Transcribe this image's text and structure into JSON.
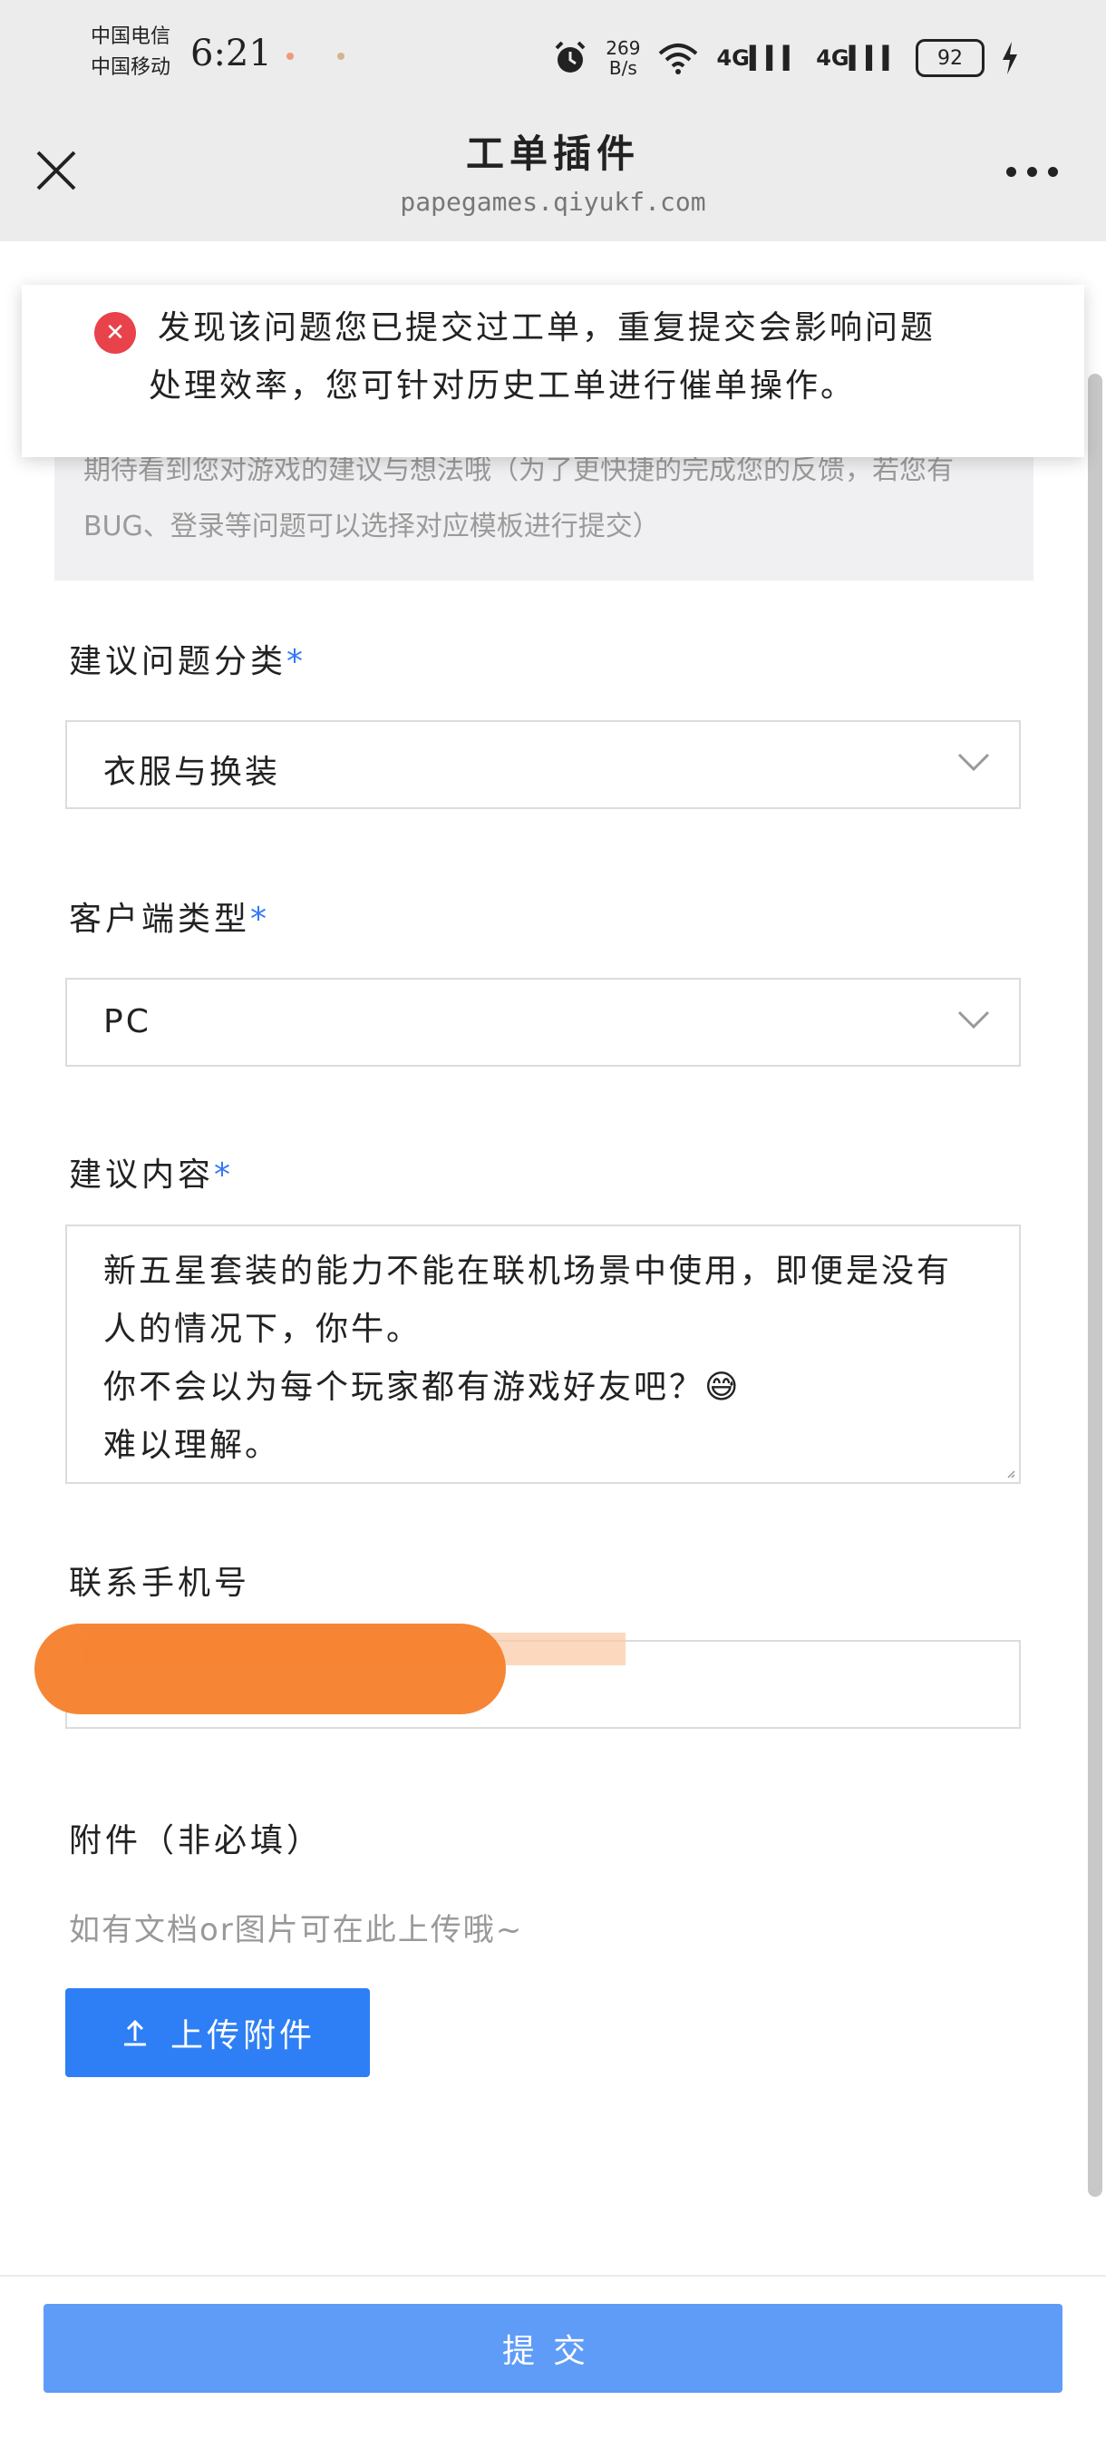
{
  "status_bar": {
    "carrier1": "中国电信",
    "carrier2": "中国移动",
    "time": "6:21",
    "speed_value": "269",
    "speed_unit": "B/s",
    "network1": "4G",
    "network2": "4G",
    "battery": "92"
  },
  "nav": {
    "title": "工单插件",
    "url": "papegames.qiyukf.com"
  },
  "toast": {
    "line1": "发现该问题您已提交过工单，重复提交会影响问题",
    "line2": "处理效率，您可针对历史工单进行催单操作。"
  },
  "intro": {
    "text": "期待看到您对游戏的建议与想法哦（为了更快捷的完成您的反馈，若您有BUG、登录等问题可以选择对应模板进行提交）"
  },
  "form": {
    "category_label": "建议问题分类",
    "category_value": "衣服与换装",
    "client_label": "客户端类型",
    "client_value": "PC",
    "content_label": "建议内容",
    "content_value": "新五星套装的能力不能在联机场景中使用，即便是没有人的情况下，你牛。\n你不会以为每个玩家都有游戏好友吧？😅\n难以理解。",
    "phone_label": "联系手机号",
    "attachment_label": "附件（非必填）",
    "attachment_hint": "如有文档or图片可在此上传哦~",
    "upload_label": "上传附件",
    "required_mark": "*"
  },
  "submit_label": "提交",
  "colors": {
    "accent": "#2e7ff5",
    "submit": "#5f9cf8",
    "error": "#e8424a",
    "redaction": "#f57f2b"
  }
}
